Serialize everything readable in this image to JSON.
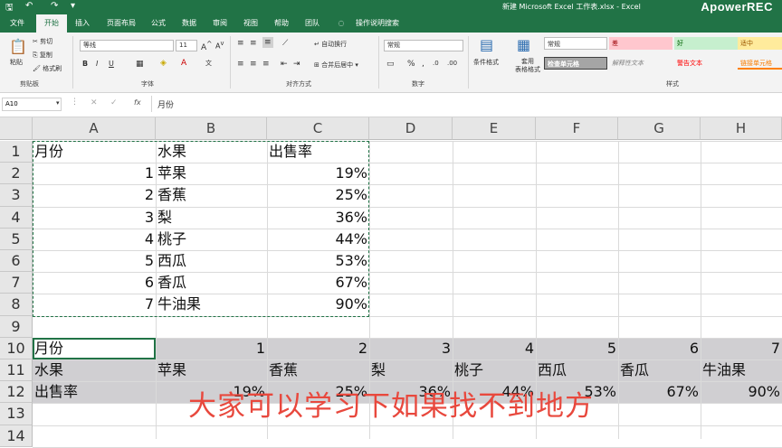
{
  "titlebar": {
    "doc_title": "新建 Microsoft Excel 工作表.xlsx  -  Excel",
    "watermark": "ApowerREC"
  },
  "tabs": [
    "文件",
    "开始",
    "插入",
    "页面布局",
    "公式",
    "数据",
    "审阅",
    "视图",
    "帮助",
    "团队",
    "操作说明搜索"
  ],
  "ribbon": {
    "clipboard": {
      "paste": "粘贴",
      "cut": "剪切",
      "copy": "复制",
      "format_painter": "格式刷",
      "label": "剪贴板"
    },
    "font": {
      "name": "等线",
      "size": "11",
      "label": "字体"
    },
    "alignment": {
      "wrap": "自动换行",
      "merge": "合并后居中",
      "label": "对齐方式"
    },
    "number": {
      "format": "常规",
      "label": "数字"
    },
    "cond_format": "条件格式",
    "table_format": "套用\n表格格式",
    "styles": {
      "normal": "常规",
      "bad": "差",
      "good": "好",
      "neutral": "适中",
      "check": "检查单元格",
      "explain": "解释性文本",
      "warn": "警告文本",
      "link": "链接单元格",
      "label": "样式"
    }
  },
  "formula_bar": {
    "name_box": "A10",
    "fx": "fx",
    "value": "月份"
  },
  "columns": [
    "A",
    "B",
    "C",
    "D",
    "E",
    "F",
    "G",
    "H"
  ],
  "rows": [
    "1",
    "2",
    "3",
    "4",
    "5",
    "6",
    "7",
    "8",
    "9",
    "10",
    "11",
    "12",
    "13",
    "14"
  ],
  "table": {
    "headers": [
      "月份",
      "水果",
      "出售率"
    ],
    "rows": [
      [
        "1",
        "苹果",
        "19%"
      ],
      [
        "2",
        "香蕉",
        "25%"
      ],
      [
        "3",
        "梨",
        "36%"
      ],
      [
        "4",
        "桃子",
        "44%"
      ],
      [
        "5",
        "西瓜",
        "53%"
      ],
      [
        "6",
        "香瓜",
        "67%"
      ],
      [
        "7",
        "牛油果",
        "90%"
      ]
    ]
  },
  "transposed": {
    "row10": [
      "月份",
      "1",
      "2",
      "3",
      "4",
      "5",
      "6",
      "7"
    ],
    "row11": [
      "水果",
      "苹果",
      "香蕉",
      "梨",
      "桃子",
      "西瓜",
      "香瓜",
      "牛油果"
    ],
    "row12": [
      "出售率",
      "19%",
      "25%",
      "36%",
      "44%",
      "53%",
      "67%",
      "90%"
    ]
  },
  "subtitle": "大家可以学习下如果找不到地方",
  "colors": {
    "accent": "#217346",
    "highlight": "#d0cfd2",
    "subtitle": "#e8483d"
  }
}
